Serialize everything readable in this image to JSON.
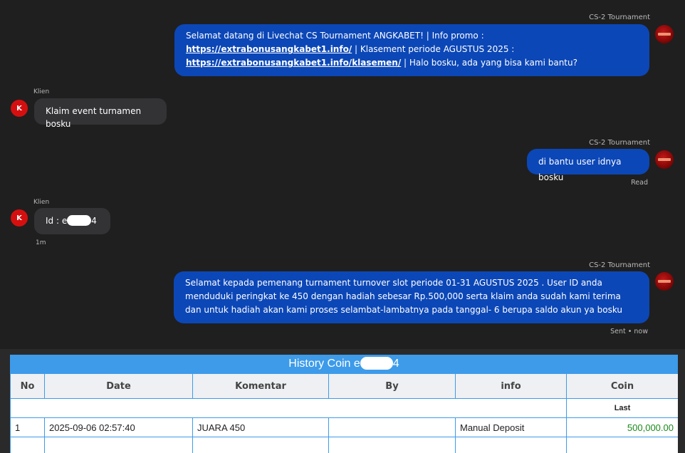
{
  "chat": {
    "agent_name": "CS-2 Tournament",
    "client_name": "Klien",
    "client_avatar_letter": "K",
    "messages": {
      "welcome": {
        "text1": "Selamat datang di Livechat CS Tournament ANGKABET! | Info promo : ",
        "link1": "https://extrabonusangkabet1.info/",
        "text2": " | Klasement periode AGUSTUS 2025 : ",
        "link2": "https://extrabonusangkabet1.info/klasemen/",
        "text3": " | Halo bosku, ada yang bisa kami bantu?"
      },
      "client_claim": "Klaim event turnamen bosku",
      "agent_ask": "di bantu user idnya bosku",
      "agent_ask_status": "Read",
      "client_id_prefix": "Id : e",
      "client_id_suffix": "4",
      "client_id_time": "1m",
      "agent_congrats": "Selamat kepada pemenang turnament turnover slot periode 01-31 AGUSTUS 2025 . User ID anda menduduki peringkat ke 450 dengan hadiah sebesar Rp.500,000 serta klaim anda sudah kami terima dan untuk hadiah akan kami proses selambat-lambatnya pada tanggal- 6 berupa saldo akun ya bosku",
      "agent_congrats_status": "Sent • now"
    }
  },
  "history": {
    "title_prefix": "History Coin e",
    "title_suffix": "4",
    "columns": [
      "No",
      "Date",
      "Komentar",
      "By",
      "info",
      "Coin"
    ],
    "last_label": "Last",
    "rows": [
      {
        "no": "1",
        "date": "2025-09-06 02:57:40",
        "komentar": "JUARA 450",
        "by": "",
        "info": "Manual Deposit",
        "coin": "500,000.00"
      }
    ]
  },
  "colors": {
    "outgoing_bubble": "#0c47b7",
    "incoming_bubble": "#333336",
    "table_header_bar": "#3d9be9",
    "coin_positive": "#1a8a1a"
  }
}
